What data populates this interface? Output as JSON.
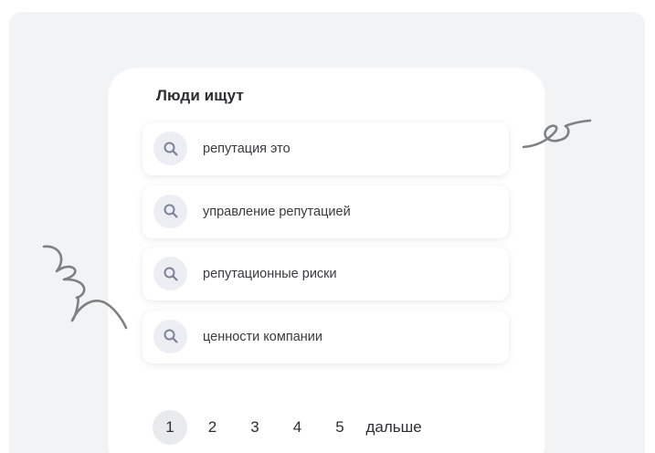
{
  "widget": {
    "title": "Люди ищут"
  },
  "suggestions": [
    {
      "label": "репутация это",
      "icon": "search-icon"
    },
    {
      "label": "управление репутацией",
      "icon": "search-icon"
    },
    {
      "label": "репутационные риски",
      "icon": "search-icon"
    },
    {
      "label": "ценности компании",
      "icon": "search-icon"
    }
  ],
  "pagination": {
    "pages": [
      "1",
      "2",
      "3",
      "4",
      "5"
    ],
    "current": "1",
    "next_label": "дальше"
  },
  "colors": {
    "background": "#f2f3f5",
    "card": "#ffffff",
    "icon_circle": "#eceef3",
    "icon_stroke": "#7c8396",
    "text": "#2c2c31",
    "doodle": "#808080"
  }
}
